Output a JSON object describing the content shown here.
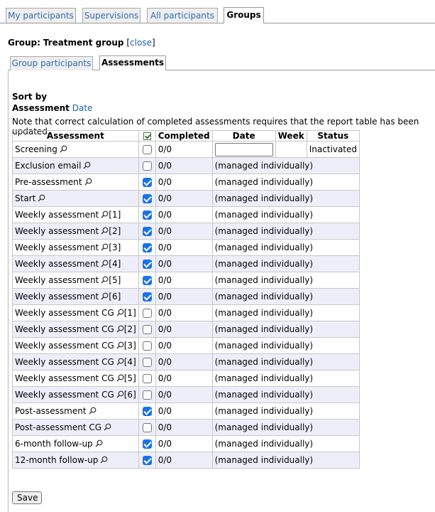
{
  "top_tabs": [
    {
      "label": "My participants",
      "active": false
    },
    {
      "label": "Supervisions",
      "active": false
    },
    {
      "label": "All participants",
      "active": false
    },
    {
      "label": "Groups",
      "active": true
    }
  ],
  "group": {
    "prefix": "Group:",
    "name": "Treatment group",
    "close_label": "close"
  },
  "sub_tabs": [
    {
      "label": "Group participants",
      "active": false
    },
    {
      "label": "Assessments",
      "active": true
    }
  ],
  "sort": {
    "title": "Sort by",
    "assessment_label": "Assessment",
    "date_link": "Date"
  },
  "note": "Note that correct calculation of completed assessments requires that the report table has been updated.",
  "table": {
    "headers": {
      "assessment": "Assessment",
      "completed": "Completed",
      "date": "Date",
      "week": "Week",
      "status": "Status"
    },
    "rows": [
      {
        "name": "Screening",
        "index": "",
        "checked": false,
        "completed": "0/0",
        "date": "",
        "week": "",
        "status": "Inactivated"
      },
      {
        "name": "Exclusion email",
        "index": "",
        "checked": false,
        "completed": "0/0",
        "date": "(managed individually)"
      },
      {
        "name": "Pre-assessment",
        "index": "",
        "checked": true,
        "completed": "0/0",
        "date": "(managed individually)"
      },
      {
        "name": "Start",
        "index": "",
        "checked": true,
        "completed": "0/0",
        "date": "(managed individually)"
      },
      {
        "name": "Weekly assessment",
        "index": "[1]",
        "checked": true,
        "completed": "0/0",
        "date": "(managed individually)"
      },
      {
        "name": "Weekly assessment",
        "index": "[2]",
        "checked": true,
        "completed": "0/0",
        "date": "(managed individually)"
      },
      {
        "name": "Weekly assessment",
        "index": "[3]",
        "checked": true,
        "completed": "0/0",
        "date": "(managed individually)"
      },
      {
        "name": "Weekly assessment",
        "index": "[4]",
        "checked": true,
        "completed": "0/0",
        "date": "(managed individually)"
      },
      {
        "name": "Weekly assessment",
        "index": "[5]",
        "checked": true,
        "completed": "0/0",
        "date": "(managed individually)"
      },
      {
        "name": "Weekly assessment",
        "index": "[6]",
        "checked": true,
        "completed": "0/0",
        "date": "(managed individually)"
      },
      {
        "name": "Weekly assessment CG",
        "index": "[1]",
        "checked": false,
        "completed": "0/0",
        "date": "(managed individually)"
      },
      {
        "name": "Weekly assessment CG",
        "index": "[2]",
        "checked": false,
        "completed": "0/0",
        "date": "(managed individually)"
      },
      {
        "name": "Weekly assessment CG",
        "index": "[3]",
        "checked": false,
        "completed": "0/0",
        "date": "(managed individually)"
      },
      {
        "name": "Weekly assessment CG",
        "index": "[4]",
        "checked": false,
        "completed": "0/0",
        "date": "(managed individually)"
      },
      {
        "name": "Weekly assessment CG",
        "index": "[5]",
        "checked": false,
        "completed": "0/0",
        "date": "(managed individually)"
      },
      {
        "name": "Weekly assessment CG",
        "index": "[6]",
        "checked": false,
        "completed": "0/0",
        "date": "(managed individually)"
      },
      {
        "name": "Post-assessment",
        "index": "",
        "checked": true,
        "completed": "0/0",
        "date": "(managed individually)"
      },
      {
        "name": "Post-assessment CG",
        "index": "",
        "checked": false,
        "completed": "0/0",
        "date": "(managed individually)"
      },
      {
        "name": "6-month follow-up",
        "index": "",
        "checked": true,
        "completed": "0/0",
        "date": "(managed individually)"
      },
      {
        "name": "12-month follow-up",
        "index": "",
        "checked": true,
        "completed": "0/0",
        "date": "(managed individually)"
      }
    ]
  },
  "save_label": "Save"
}
